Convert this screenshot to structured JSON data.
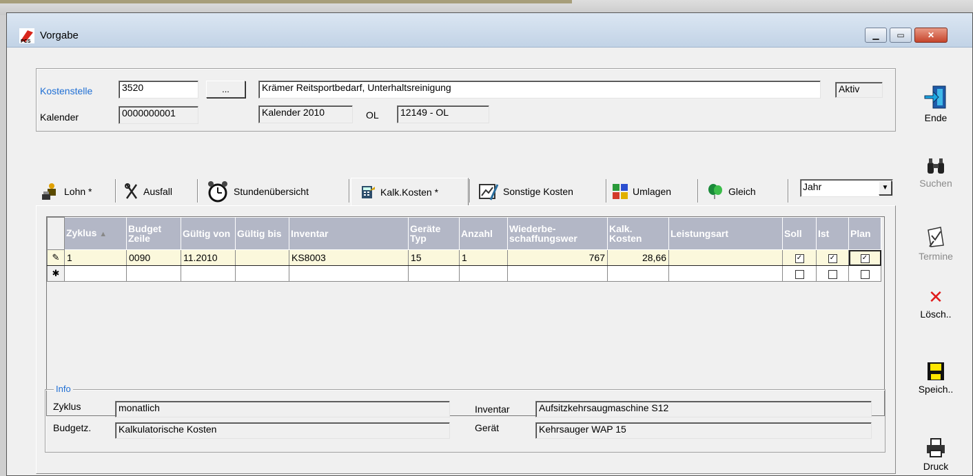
{
  "window": {
    "title": "Vorgabe",
    "app_icon": "pcs-logo-icon"
  },
  "header": {
    "kostenstelle_label": "Kostenstelle",
    "kostenstelle_value": "3520",
    "browse_label": "...",
    "description": "Krämer Reitsportbedarf, Unterhaltsreinigung",
    "status": "Aktiv",
    "kalender_label": "Kalender",
    "kalender_value": "0000000001",
    "kalender_name": "Kalender 2010",
    "ol_label": "OL",
    "ol_value": "12149 - OL"
  },
  "tabs": [
    {
      "label": "Lohn *",
      "icon": "worker-icon"
    },
    {
      "label": "Ausfall",
      "icon": "tools-icon"
    },
    {
      "label": "Stundenübersicht",
      "icon": "alarm-clock-icon"
    },
    {
      "label": "Kalk.Kosten *",
      "icon": "calculator-icon",
      "active": true
    },
    {
      "label": "Sonstige Kosten",
      "icon": "chart-edit-icon"
    },
    {
      "label": "Umlagen",
      "icon": "puzzle-icon"
    },
    {
      "label": "Gleich",
      "icon": "balloon-icon"
    }
  ],
  "period_select": {
    "value": "Jahr"
  },
  "grid": {
    "columns": [
      "Zyklus",
      "Budget Zeile",
      "Gültig von",
      "Gültig bis",
      "Inventar",
      "Geräte Typ",
      "Anzahl",
      "Wiederbe-schaffungswer",
      "Kalk. Kosten",
      "Leistungsart",
      "Soll",
      "Ist",
      "Plan"
    ],
    "rows": [
      {
        "zyklus": "1",
        "budget_zeile": "0090",
        "gueltig_von": "11.2010",
        "gueltig_bis": "",
        "inventar": "KS8003",
        "geraete_typ": "15",
        "anzahl": "1",
        "wiederbeschaffungswert": "767",
        "kalk_kosten": "28,66",
        "leistungsart": "",
        "soll": true,
        "ist": true,
        "plan": true
      }
    ]
  },
  "info": {
    "legend": "Info",
    "zyklus_label": "Zyklus",
    "zyklus_value": "monatlich",
    "budgetz_label": "Budgetz.",
    "budgetz_value": "Kalkulatorische Kosten",
    "inventar_label": "Inventar",
    "inventar_value": "Aufsitzkehrsaugmaschine S12",
    "geraet_label": "Gerät",
    "geraet_value": "Kehrsauger WAP 15"
  },
  "toolbar": {
    "ende": "Ende",
    "suchen": "Suchen",
    "termine": "Termine",
    "loesch": "Lösch..",
    "speich": "Speich..",
    "druck": "Druck"
  },
  "colors": {
    "header_bg": "#b3b7c6",
    "link_blue": "#1f6fd4",
    "edit_row": "#fbf8dc"
  }
}
